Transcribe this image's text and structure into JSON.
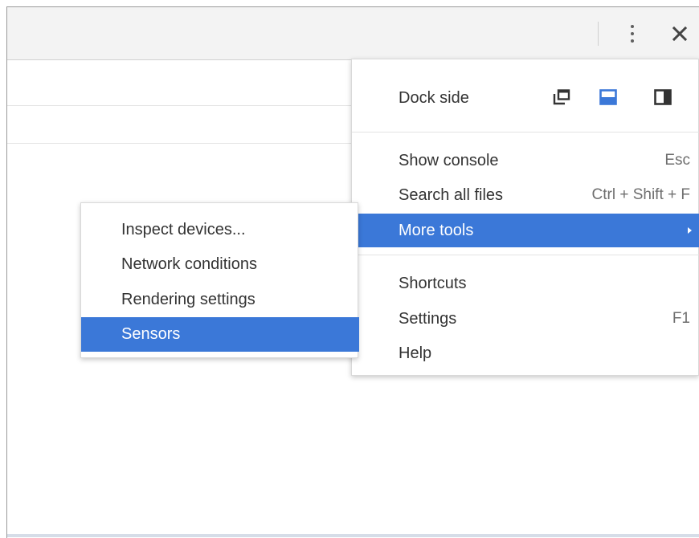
{
  "toolbar": {
    "more_icon": "vertical-ellipsis-icon",
    "close_icon": "close-icon"
  },
  "menu": {
    "dock_side_label": "Dock side",
    "dock_icons": [
      "undock-into-separate-window-icon",
      "dock-to-bottom-icon",
      "dock-to-right-icon"
    ],
    "selected_dock": "dock-to-bottom-icon",
    "items": [
      {
        "label": "Show console",
        "shortcut": "Esc"
      },
      {
        "label": "Search all files",
        "shortcut": "Ctrl + Shift + F"
      },
      {
        "label": "More tools",
        "shortcut": "",
        "highlighted": true
      },
      {
        "label": "Shortcuts",
        "shortcut": ""
      },
      {
        "label": "Settings",
        "shortcut": "F1"
      },
      {
        "label": "Help",
        "shortcut": ""
      }
    ]
  },
  "submenu": {
    "items": [
      {
        "label": "Inspect devices..."
      },
      {
        "label": "Network conditions"
      },
      {
        "label": "Rendering settings"
      },
      {
        "label": "Sensors",
        "highlighted": true
      }
    ]
  },
  "colors": {
    "highlight": "#3b78d8",
    "selected_dock_icon": "#3b78d8",
    "text": "#333333",
    "shortcut_text": "#6e6e6e"
  }
}
